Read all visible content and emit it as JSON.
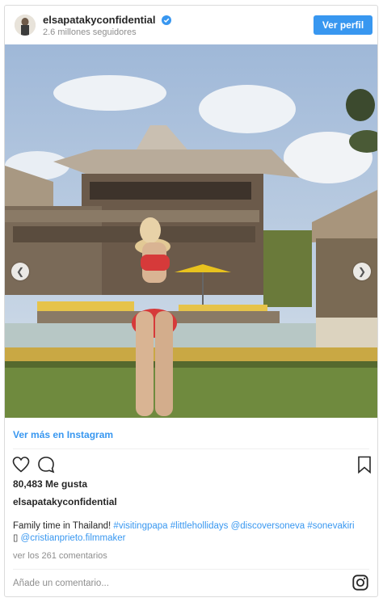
{
  "header": {
    "username": "elsapatakyconfidential",
    "followers": "2.6 millones seguidores",
    "profile_button": "Ver perfil"
  },
  "photo": {
    "carousel_prev_icon": "chevron-left-icon",
    "carousel_next_icon": "chevron-right-icon"
  },
  "more_link": "Ver más en Instagram",
  "likes": "80,483 Me gusta",
  "post": {
    "owner": "elsapatakyconfidential",
    "caption_text": "Family time in Thailand! ",
    "tags": [
      "#visitingpapa",
      "#littlehollidays",
      "@discoversoneva",
      "#sonevakiri"
    ],
    "cam_glyph": "▯",
    "mention": "@cristianprieto.filmmaker"
  },
  "comments_link": "ver los 261 comentarios",
  "comment_placeholder": "Añade un comentario...",
  "colors": {
    "accent": "#3897f0",
    "text": "#262626",
    "muted": "#8e8e8e"
  }
}
